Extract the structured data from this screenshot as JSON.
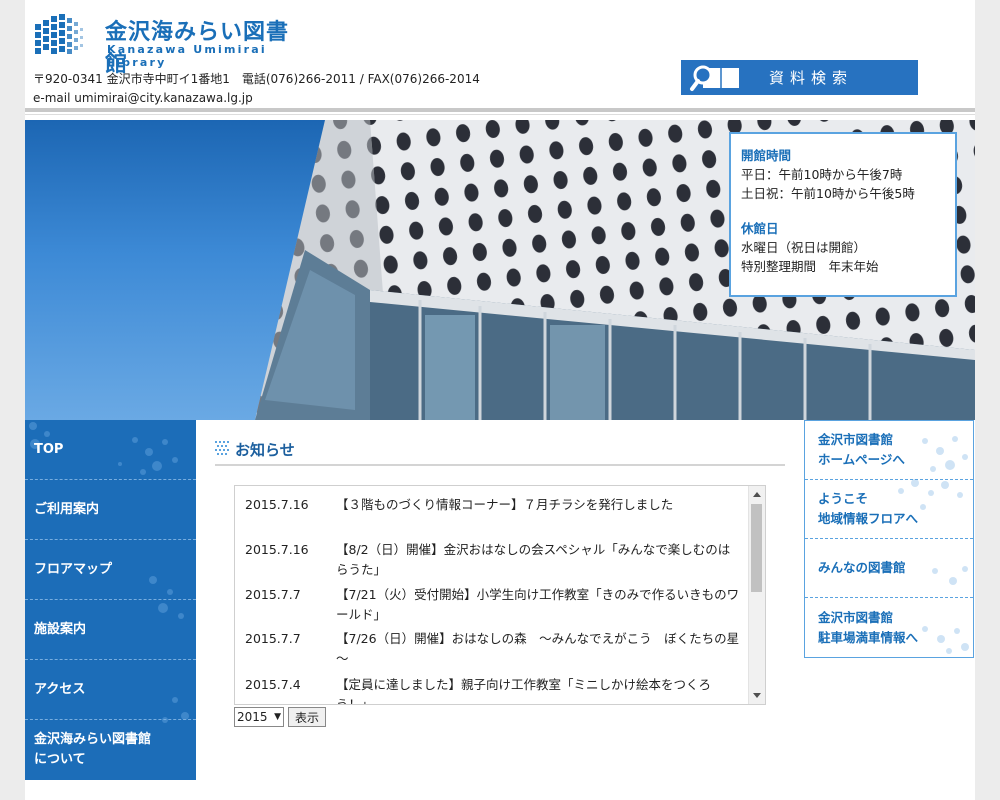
{
  "header": {
    "logo_title": "金沢海みらい図書館",
    "logo_subtitle": "Kanazawa Umimirai Library",
    "address_line1": "〒920-0341 金沢市寺中町イ1番地1　電話(076)266-2011 / FAX(076)266-2014",
    "address_line2": "e-mail umimirai@city.kanazawa.lg.jp",
    "search_label": "資料検索"
  },
  "hours": {
    "open_heading": "開館時間",
    "weekday": "平日：午前10時から午後7時",
    "weekend": "土日祝：午前10時から午後5時",
    "closed_heading": "休館日",
    "closed1": "水曜日（祝日は開館）",
    "closed2": "特別整理期間　年末年始"
  },
  "nav": {
    "items": [
      {
        "label": "TOP"
      },
      {
        "label": "ご利用案内"
      },
      {
        "label": "フロアマップ"
      },
      {
        "label": "施設案内"
      },
      {
        "label": "アクセス"
      },
      {
        "label": "金沢海みらい図書館\nについて"
      }
    ]
  },
  "news": {
    "title": "お知らせ",
    "items": [
      {
        "date": "2015.7.16",
        "text": "【３階ものづくり情報コーナー】７月チラシを発行しました"
      },
      {
        "date": "2015.7.16",
        "text": "【8/2（日）開催】金沢おはなしの会スペシャル「みんなで楽しむのはらうた」"
      },
      {
        "date": "2015.7.7",
        "text": "【7/21（火）受付開始】小学生向け工作教室「きのみで作るいきものワールド」"
      },
      {
        "date": "2015.7.7",
        "text": "【7/26（日）開催】おはなしの森　～みんなでえがこう　ぼくたちの星～"
      },
      {
        "date": "2015.7.4",
        "text": "【定員に達しました】親子向け工作教室「ミニしかけ絵本をつくろう！」"
      }
    ],
    "year_value": "2015",
    "show_label": "表示"
  },
  "rlinks": {
    "items": [
      {
        "label": "金沢市図書館\nホームページへ"
      },
      {
        "label": "ようこそ\n地域情報フロアへ"
      },
      {
        "label": "みんなの図書館"
      },
      {
        "label": "金沢市図書館\n駐車場満車情報へ"
      }
    ]
  },
  "colors": {
    "brand_blue": "#1a6fb8",
    "nav_blue": "#1c6db8",
    "search_blue": "#2772c0"
  }
}
